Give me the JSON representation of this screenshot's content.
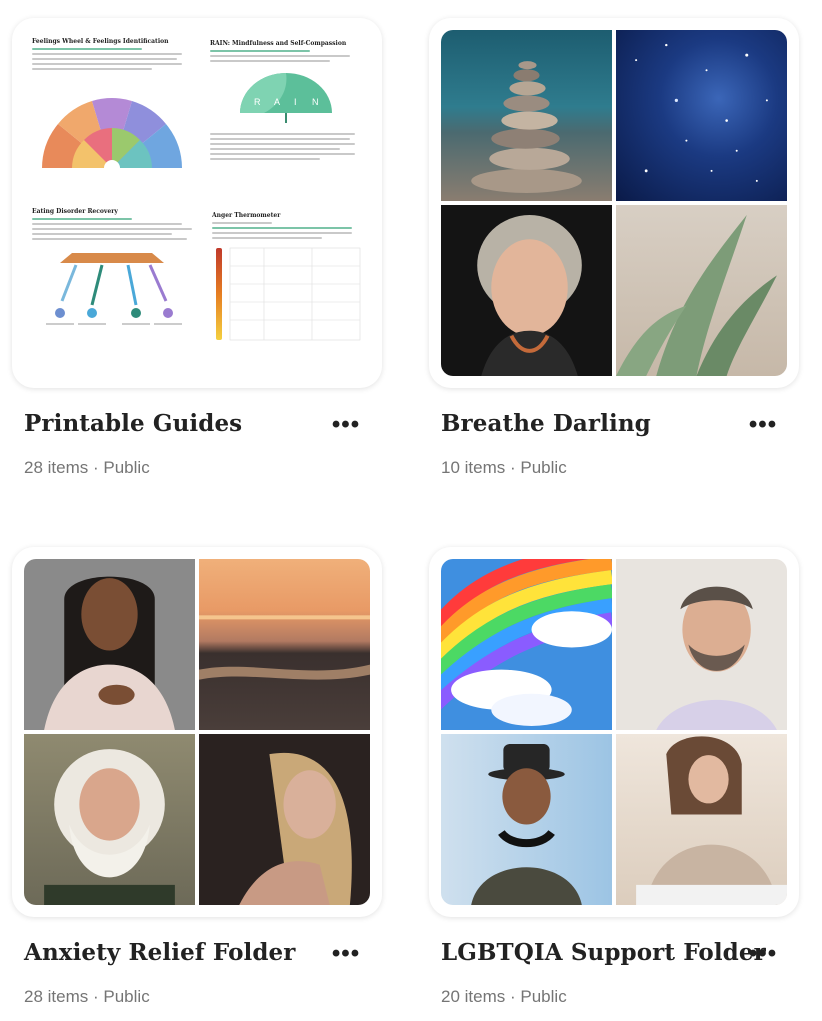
{
  "collections": [
    {
      "title": "Printable Guides",
      "count": "28 items",
      "separator": "·",
      "visibility": "Public",
      "preview": {
        "sections": [
          "Feelings Wheel & Feelings Identification",
          "RAIN: Mindfulness and Self-Compassion",
          "Eating Disorder Recovery",
          "Anger Thermometer"
        ],
        "rain_letters": [
          "R",
          "A",
          "I",
          "N"
        ]
      }
    },
    {
      "title": "Breathe Darling",
      "count": "10 items",
      "separator": "·",
      "visibility": "Public"
    },
    {
      "title": "Anxiety Relief Folder",
      "count": "28 items",
      "separator": "·",
      "visibility": "Public"
    },
    {
      "title": "LGBTQIA Support Folder",
      "count": "20 items",
      "separator": "·",
      "visibility": "Public"
    }
  ],
  "more_label": "•••",
  "colors": {
    "title": "#222222",
    "meta": "#757575",
    "accent_green": "#5cbf9a"
  }
}
